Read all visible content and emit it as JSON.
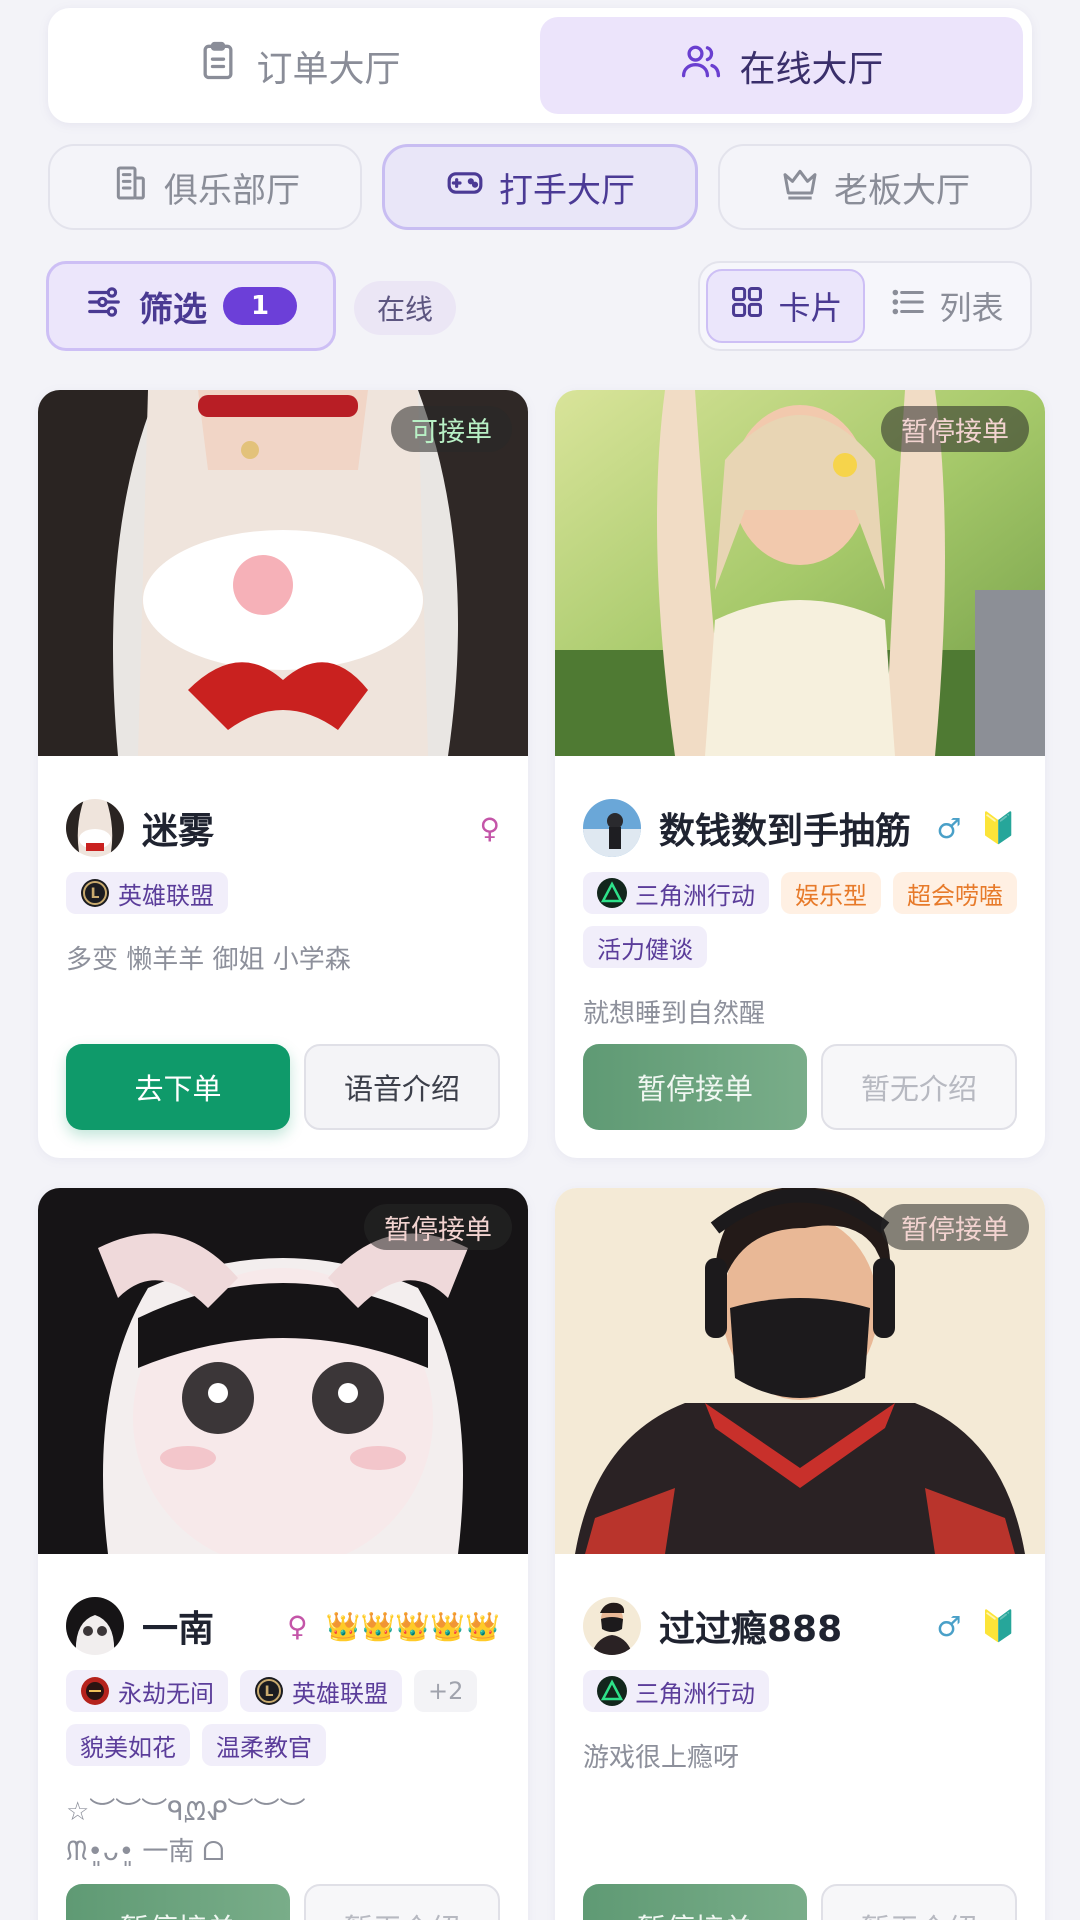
{
  "main_tabs": [
    {
      "label": "订单大厅",
      "icon": "clipboard-icon",
      "active": false
    },
    {
      "label": "在线大厅",
      "icon": "users-icon",
      "active": true
    }
  ],
  "sub_tabs": [
    {
      "label": "俱乐部厅",
      "icon": "building-icon",
      "active": false
    },
    {
      "label": "打手大厅",
      "icon": "gamepad-icon",
      "active": true
    },
    {
      "label": "老板大厅",
      "icon": "crown-icon",
      "active": false
    }
  ],
  "filter": {
    "label": "筛选",
    "count": "1",
    "chip": "在线"
  },
  "view_toggle": {
    "card": "卡片",
    "list": "列表",
    "active": "card"
  },
  "colors": {
    "accent": "#6c3fd8",
    "primary_button": "#0f9a6a",
    "paused_button": "#6aa37e"
  },
  "cards": [
    {
      "status": "可接单",
      "name": "迷雾",
      "gender": "♀",
      "badges": "",
      "games": [
        {
          "label": "英雄联盟",
          "icon": "lol-icon"
        }
      ],
      "extra_tags": [],
      "bio": "多变 懒羊羊 御姐 小学森",
      "primary_btn": "去下单",
      "secondary_btn": "语音介绍"
    },
    {
      "status": "暂停接单",
      "name": "数钱数到手抽筋",
      "gender": "♂",
      "badges": "🔰",
      "games": [
        {
          "label": "三角洲行动",
          "icon": "delta-force-icon"
        }
      ],
      "extra_tags": [
        "娱乐型",
        "超会唠嗑",
        "活力健谈"
      ],
      "bio": "就想睡到自然醒",
      "primary_btn": "暂停接单",
      "secondary_btn": "暂无介绍"
    },
    {
      "status": "暂停接单",
      "name": "一南",
      "gender": "♀",
      "badges": "👑👑👑👑👑",
      "games": [
        {
          "label": "永劫无间",
          "icon": "naraka-icon"
        },
        {
          "label": "英雄联盟",
          "icon": "lol-icon"
        }
      ],
      "more_count": "+2",
      "extra_tags": [
        "貌美如花",
        "温柔教官"
      ],
      "bio_line1": "☆︶︶︶ᑫᘻᕵ︶︶︶",
      "bio_line2": "ᙏ•͈ᴗ•͈ 一南 ᗝ",
      "primary_btn": "暂停接单",
      "secondary_btn": "暂无介绍"
    },
    {
      "status": "暂停接单",
      "name": "过过瘾888",
      "gender": "♂",
      "badges": "🔰",
      "games": [
        {
          "label": "三角洲行动",
          "icon": "delta-force-icon"
        }
      ],
      "extra_tags": [],
      "bio": "游戏很上瘾呀",
      "primary_btn": "暂停接单",
      "secondary_btn": "暂无介绍"
    }
  ]
}
